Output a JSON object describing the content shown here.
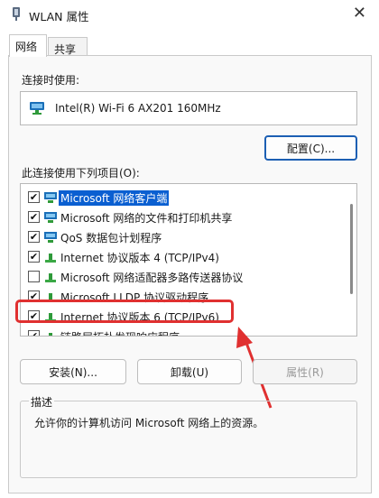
{
  "window": {
    "title": "WLAN 属性"
  },
  "tabs": [
    {
      "label": "网络"
    },
    {
      "label": "共享"
    }
  ],
  "connect_using": {
    "label": "连接时使用:",
    "adapter": "Intel(R) Wi-Fi 6 AX201 160MHz"
  },
  "buttons": {
    "configure": "配置(C)...",
    "install": "安装(N)...",
    "uninstall": "卸载(U)",
    "properties": "属性(R)"
  },
  "items_label": "此连接使用下列项目(O):",
  "items": [
    {
      "label": "Microsoft 网络客户端",
      "checked": true,
      "icon": "network-client-icon"
    },
    {
      "label": "Microsoft 网络的文件和打印机共享",
      "checked": true,
      "icon": "network-share-icon"
    },
    {
      "label": "QoS 数据包计划程序",
      "checked": true,
      "icon": "network-service-icon"
    },
    {
      "label": "Internet 协议版本 4 (TCP/IPv4)",
      "checked": true,
      "icon": "protocol-icon"
    },
    {
      "label": "Microsoft 网络适配器多路传送器协议",
      "checked": false,
      "icon": "protocol-icon"
    },
    {
      "label": "Microsoft LLDP 协议驱动程序",
      "checked": true,
      "icon": "protocol-icon"
    },
    {
      "label": "Internet 协议版本 6 (TCP/IPv6)",
      "checked": true,
      "icon": "protocol-icon"
    },
    {
      "label": "链路层拓扑发现响应程序",
      "checked": true,
      "icon": "protocol-icon"
    }
  ],
  "description": {
    "legend": "描述",
    "text": "允许你的计算机访问 Microsoft 网络上的资源。"
  },
  "colors": {
    "selection": "#0a5fd1",
    "highlight_annotation": "#e03030",
    "primary_button_border": "#1c5fb3"
  }
}
